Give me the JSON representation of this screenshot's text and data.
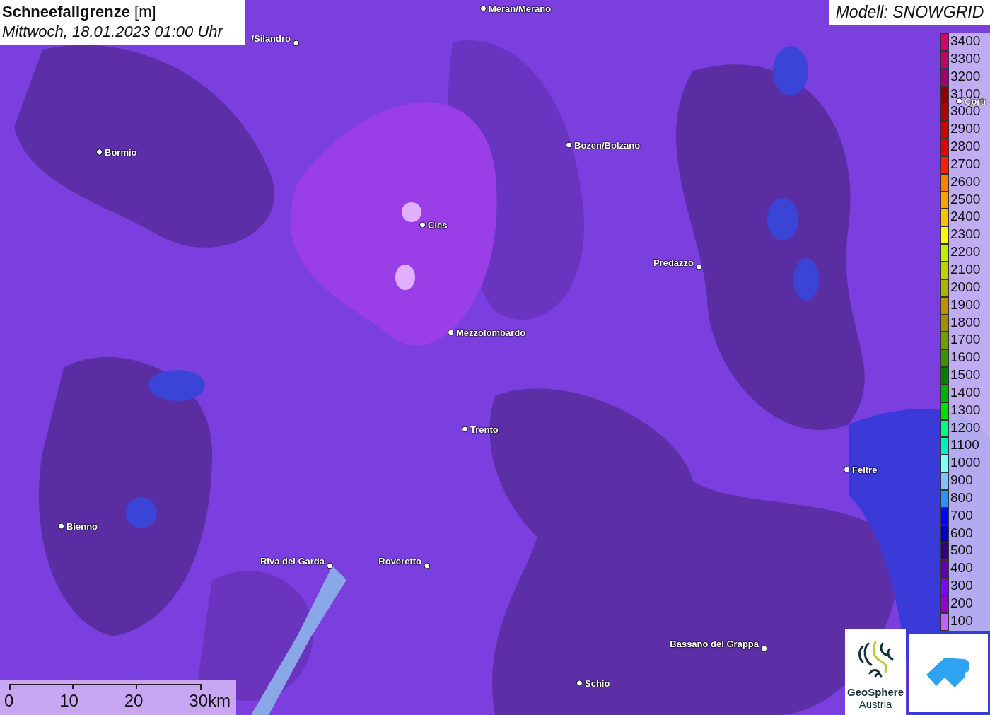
{
  "title": {
    "heading": "**Schneefallgrenze** [m]",
    "datetime": "Mittwoch, 18.01.2023 01:00 Uhr"
  },
  "model_label": "Modell: SNOWGRID",
  "cities": [
    {
      "name": "Meran/Merano"
    },
    {
      "name": "/Silandro"
    },
    {
      "name": "Bormio"
    },
    {
      "name": "Bozen/Bolzano"
    },
    {
      "name": "Cles"
    },
    {
      "name": "Predazzo"
    },
    {
      "name": "Mezzolombardo"
    },
    {
      "name": "Trento"
    },
    {
      "name": "Feltre"
    },
    {
      "name": "Bienno"
    },
    {
      "name": "Riva del Garda"
    },
    {
      "name": "Roveretto"
    },
    {
      "name": "Bassano del Grappa"
    },
    {
      "name": "Schio"
    },
    {
      "name": "Corti"
    }
  ],
  "legend": [
    {
      "label": "3400",
      "color": "#d4006e"
    },
    {
      "label": "3300",
      "color": "#c4006a"
    },
    {
      "label": "3200",
      "color": "#a00070"
    },
    {
      "label": "3100",
      "color": "#8b0000"
    },
    {
      "label": "3000",
      "color": "#b00000"
    },
    {
      "label": "2900",
      "color": "#d00000"
    },
    {
      "label": "2800",
      "color": "#e80000"
    },
    {
      "label": "2700",
      "color": "#ff2000"
    },
    {
      "label": "2600",
      "color": "#ff8000"
    },
    {
      "label": "2500",
      "color": "#ffa000"
    },
    {
      "label": "2400",
      "color": "#ffc000"
    },
    {
      "label": "2300",
      "color": "#ffff00"
    },
    {
      "label": "2200",
      "color": "#c0f000"
    },
    {
      "label": "2100",
      "color": "#c0d000"
    },
    {
      "label": "2000",
      "color": "#b0b000"
    },
    {
      "label": "1900",
      "color": "#c09000"
    },
    {
      "label": "1800",
      "color": "#a09000"
    },
    {
      "label": "1700",
      "color": "#70a000"
    },
    {
      "label": "1600",
      "color": "#409000"
    },
    {
      "label": "1500",
      "color": "#008000"
    },
    {
      "label": "1400",
      "color": "#00b000"
    },
    {
      "label": "1300",
      "color": "#00e000"
    },
    {
      "label": "1200",
      "color": "#00ff80"
    },
    {
      "label": "1100",
      "color": "#00f0c0"
    },
    {
      "label": "1000",
      "color": "#80ffff"
    },
    {
      "label": "900",
      "color": "#80c0ff"
    },
    {
      "label": "800",
      "color": "#3090ff"
    },
    {
      "label": "700",
      "color": "#0000ff"
    },
    {
      "label": "600",
      "color": "#0000c0"
    },
    {
      "label": "500",
      "color": "#300080"
    },
    {
      "label": "400",
      "color": "#6000b0"
    },
    {
      "label": "300",
      "color": "#8000ff"
    },
    {
      "label": "200",
      "color": "#9000d0"
    },
    {
      "label": "100",
      "color": "#c060ff"
    }
  ],
  "scale_bar": {
    "ticks": [
      "0",
      "10",
      "20",
      "30km"
    ]
  },
  "logo": {
    "name": "GeoSphere",
    "subtitle": "Austria"
  }
}
